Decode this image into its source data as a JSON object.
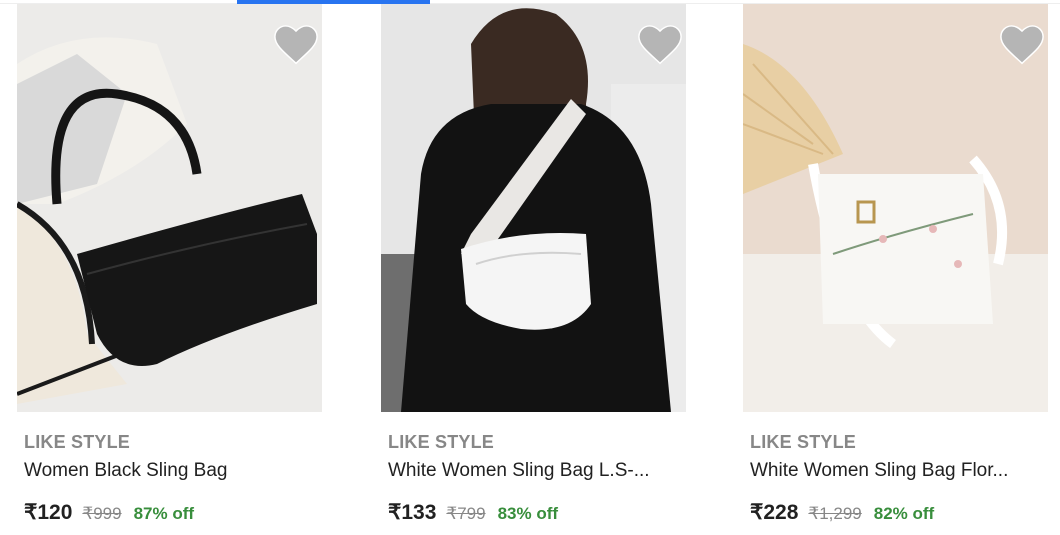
{
  "products": [
    {
      "brand": "LIKE STYLE",
      "title": "Women Black Sling Bag",
      "price": "₹120",
      "mrp": "₹999",
      "discount": "87% off",
      "wishlist_icon": "heart-icon"
    },
    {
      "brand": "LIKE STYLE",
      "title": "White Women Sling Bag L.S-...",
      "price": "₹133",
      "mrp": "₹799",
      "discount": "83% off",
      "wishlist_icon": "heart-icon"
    },
    {
      "brand": "LIKE STYLE",
      "title": "White Women Sling Bag Flor...",
      "price": "₹228",
      "mrp": "₹1,299",
      "discount": "82% off",
      "wishlist_icon": "heart-icon"
    }
  ],
  "colors": {
    "accent": "#2874f0",
    "discount": "#388e3c",
    "brand": "#878787",
    "wishlist": "#b5b5b5"
  }
}
